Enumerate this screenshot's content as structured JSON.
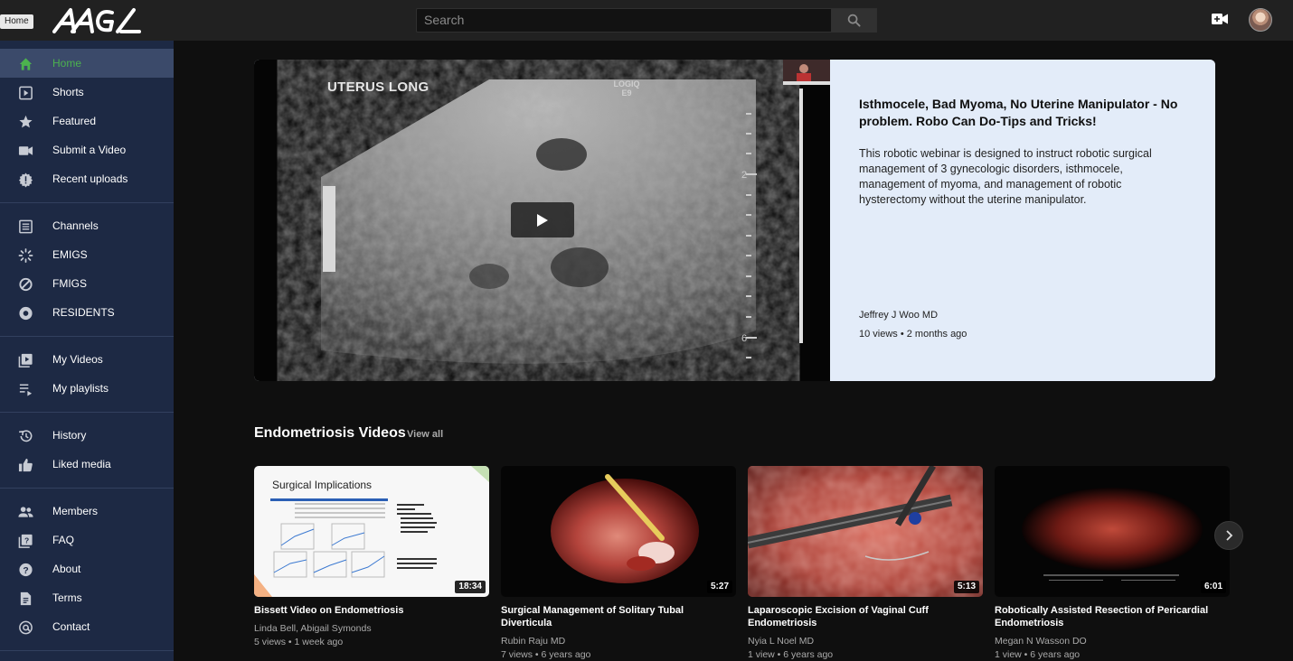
{
  "tooltip": "Home",
  "search": {
    "placeholder": "Search"
  },
  "sidebar": {
    "groups": [
      [
        {
          "label": "Home",
          "icon": "home-icon",
          "active": true
        },
        {
          "label": "Shorts",
          "icon": "shorts-icon"
        },
        {
          "label": "Featured",
          "icon": "star-icon"
        },
        {
          "label": "Submit a Video",
          "icon": "video-camera-icon"
        },
        {
          "label": "Recent uploads",
          "icon": "recent-uploads-icon"
        }
      ],
      [
        {
          "label": "Channels",
          "icon": "channels-icon"
        },
        {
          "label": "EMIGS",
          "icon": "emigs-icon"
        },
        {
          "label": "FMIGS",
          "icon": "fmigs-icon"
        },
        {
          "label": "RESIDENTS",
          "icon": "residents-icon"
        }
      ],
      [
        {
          "label": "My Videos",
          "icon": "my-videos-icon"
        },
        {
          "label": "My playlists",
          "icon": "playlist-icon"
        }
      ],
      [
        {
          "label": "History",
          "icon": "history-icon"
        },
        {
          "label": "Liked media",
          "icon": "thumbs-up-icon"
        }
      ],
      [
        {
          "label": "Members",
          "icon": "members-icon"
        },
        {
          "label": "FAQ",
          "icon": "faq-icon"
        },
        {
          "label": "About",
          "icon": "help-icon"
        },
        {
          "label": "Terms",
          "icon": "document-icon"
        },
        {
          "label": "Contact",
          "icon": "at-sign-icon"
        }
      ]
    ]
  },
  "featured": {
    "video_label": "UTERUS LONG",
    "machine_label": "LOGIQ\nE9",
    "title": "Isthmocele, Bad Myoma, No Uterine Manipulator - No problem. Robo Can Do-Tips and Tricks!",
    "description": "This robotic webinar is designed to instruct robotic surgical management of 3 gynecologic disorders, isthmocele, management of myoma, and management of robotic hysterectomy without the uterine manipulator.",
    "author": "Jeffrey J Woo MD",
    "meta": "10 views • 2 months ago"
  },
  "section": {
    "title": "Endometriosis Videos",
    "view_all": "View all",
    "videos": [
      {
        "title": "Bissett Video on Endometriosis",
        "author": "Linda Bell, Abigail Symonds",
        "meta": "5 views • 1 week ago",
        "duration": "18:34",
        "slide_title": "Surgical Implications"
      },
      {
        "title": "Surgical Management of Solitary Tubal Diverticula",
        "author": "Rubin Raju MD",
        "meta": "7 views • 6 years ago",
        "duration": "5:27"
      },
      {
        "title": "Laparoscopic Excision of Vaginal Cuff Endometriosis",
        "author": "Nyia L Noel MD",
        "meta": "1 view • 6 years ago",
        "duration": "5:13"
      },
      {
        "title": "Robotically Assisted Resection of Pericardial Endometriosis",
        "author": "Megan N Wasson DO",
        "meta": "1 view • 6 years ago",
        "duration": "6:01"
      }
    ]
  },
  "colors": {
    "sidebar_bg": "#1d2944",
    "active_green": "#4cb24e",
    "featured_bg": "#e3ecf9"
  }
}
